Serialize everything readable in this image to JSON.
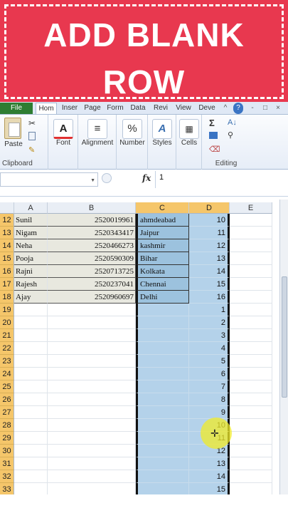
{
  "banner": {
    "line1": "ADD BLANK",
    "line2": "ROW"
  },
  "tabs": [
    "File",
    "Hom",
    "Inser",
    "Page",
    "Form",
    "Data",
    "Revi",
    "View",
    "Deve"
  ],
  "window_controls": [
    "^",
    "?",
    "-",
    "□",
    "×"
  ],
  "ribbon": {
    "clipboard": {
      "paste": "Paste",
      "label": "Clipboard"
    },
    "font": "Font",
    "alignment": "Alignment",
    "number": "Number",
    "styles": "Styles",
    "cells": "Cells",
    "editing": "Editing",
    "number_icon": "%",
    "sum_icon": "Σ"
  },
  "formula_bar": {
    "fx": "fx",
    "value": "1"
  },
  "columns": [
    "A",
    "B",
    "C",
    "D",
    "E"
  ],
  "rows": [
    {
      "n": "12",
      "a": "Sunil",
      "b": "2520019961",
      "c": "ahmdeabad",
      "d": "10"
    },
    {
      "n": "13",
      "a": "Nigam",
      "b": "2520343417",
      "c": "Jaipur",
      "d": "11"
    },
    {
      "n": "14",
      "a": "Neha",
      "b": "2520466273",
      "c": "kashmir",
      "d": "12"
    },
    {
      "n": "15",
      "a": "Pooja",
      "b": "2520590309",
      "c": "Bihar",
      "d": "13"
    },
    {
      "n": "16",
      "a": "Rajni",
      "b": "2520713725",
      "c": "Kolkata",
      "d": "14"
    },
    {
      "n": "17",
      "a": "Rajesh",
      "b": "2520237041",
      "c": "Chennai",
      "d": "15"
    },
    {
      "n": "18",
      "a": "Ajay",
      "b": "2520960697",
      "c": "Delhi",
      "d": "16"
    },
    {
      "n": "19",
      "a": "",
      "b": "",
      "c": "",
      "d": "1"
    },
    {
      "n": "20",
      "a": "",
      "b": "",
      "c": "",
      "d": "2"
    },
    {
      "n": "21",
      "a": "",
      "b": "",
      "c": "",
      "d": "3"
    },
    {
      "n": "22",
      "a": "",
      "b": "",
      "c": "",
      "d": "4"
    },
    {
      "n": "23",
      "a": "",
      "b": "",
      "c": "",
      "d": "5"
    },
    {
      "n": "24",
      "a": "",
      "b": "",
      "c": "",
      "d": "6"
    },
    {
      "n": "25",
      "a": "",
      "b": "",
      "c": "",
      "d": "7"
    },
    {
      "n": "26",
      "a": "",
      "b": "",
      "c": "",
      "d": "8"
    },
    {
      "n": "27",
      "a": "",
      "b": "",
      "c": "",
      "d": "9"
    },
    {
      "n": "28",
      "a": "",
      "b": "",
      "c": "",
      "d": "10"
    },
    {
      "n": "29",
      "a": "",
      "b": "",
      "c": "",
      "d": "11"
    },
    {
      "n": "30",
      "a": "",
      "b": "",
      "c": "",
      "d": "12"
    },
    {
      "n": "31",
      "a": "",
      "b": "",
      "c": "",
      "d": "13"
    },
    {
      "n": "32",
      "a": "",
      "b": "",
      "c": "",
      "d": "14"
    },
    {
      "n": "33",
      "a": "",
      "b": "",
      "c": "",
      "d": "15"
    }
  ],
  "colors": {
    "banner": "#e8384f",
    "selection": "#b4d2ea",
    "row_header": "#f5c66a",
    "file_tab": "#2e7d32"
  }
}
